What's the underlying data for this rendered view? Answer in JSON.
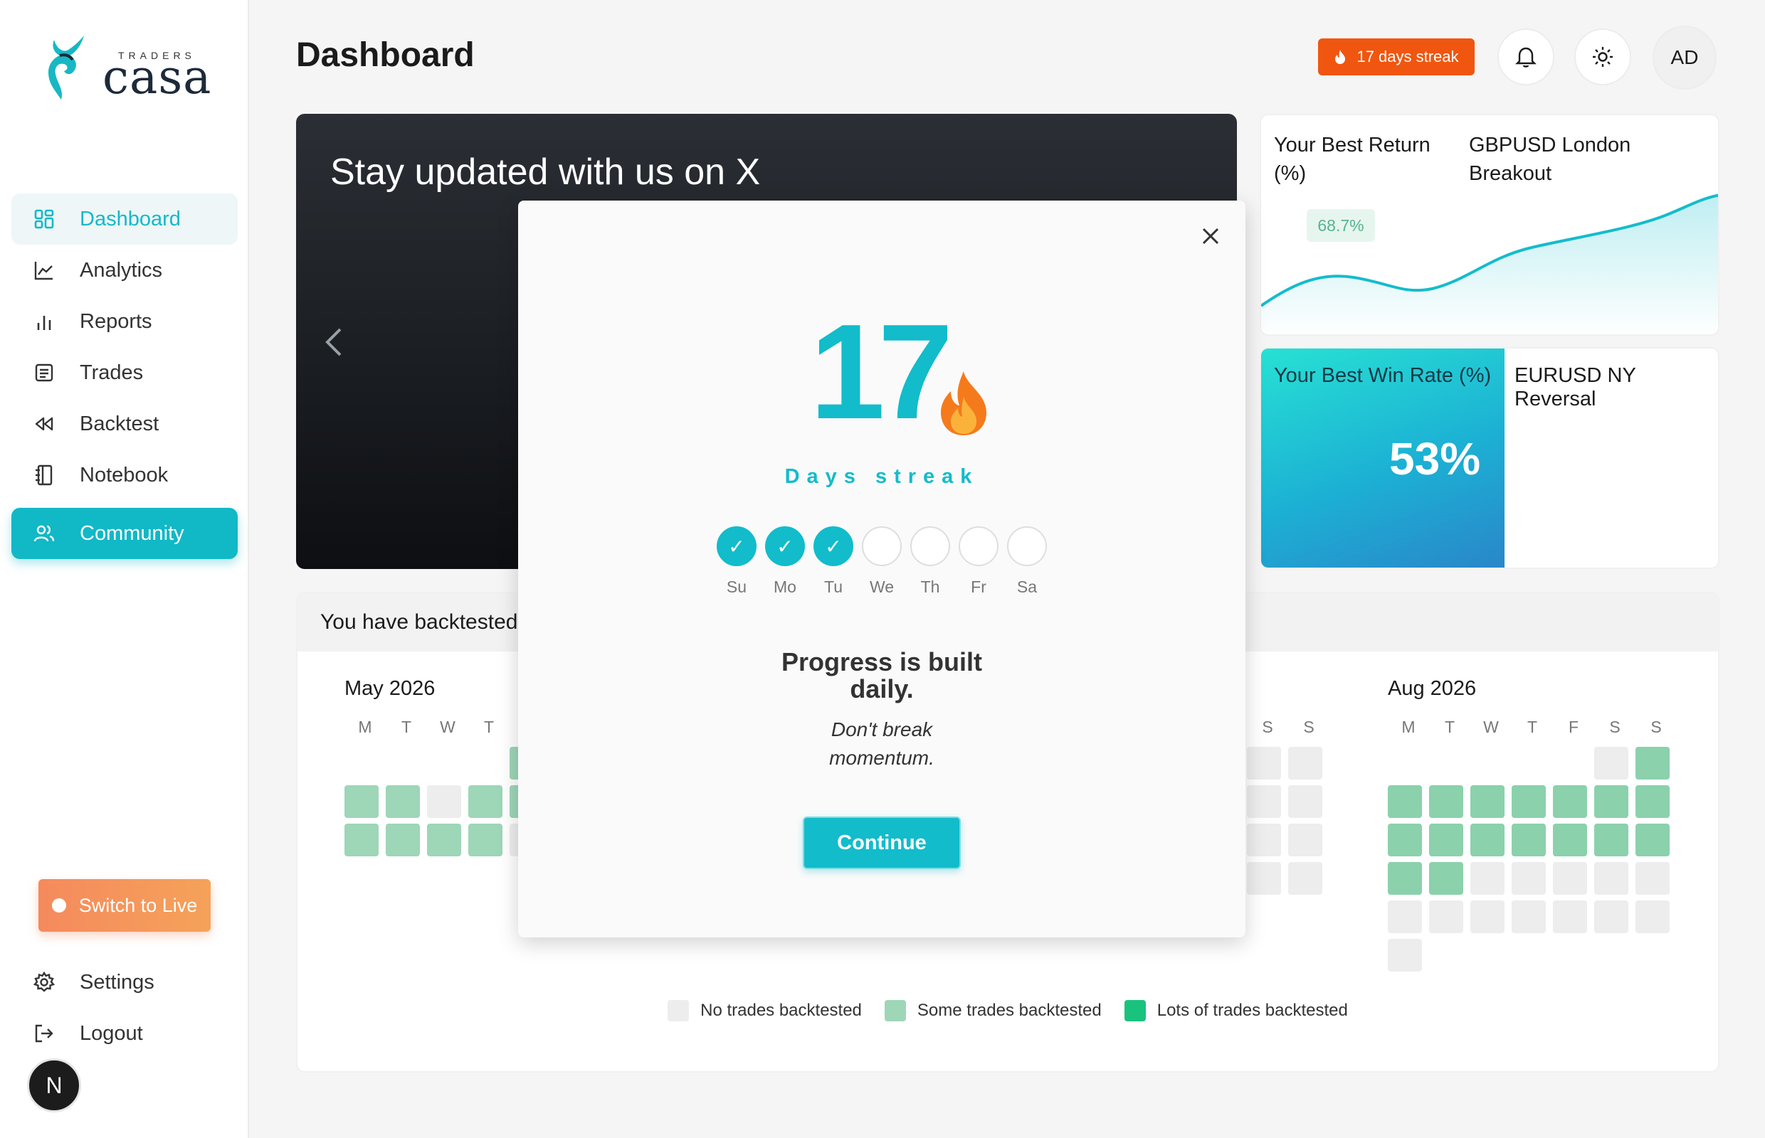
{
  "sidebar": {
    "logo": {
      "small": "TRADERS",
      "big": "casa"
    },
    "items": [
      {
        "label": "Dashboard",
        "icon": "grid-icon"
      },
      {
        "label": "Analytics",
        "icon": "line-chart-icon"
      },
      {
        "label": "Reports",
        "icon": "bar-chart-icon"
      },
      {
        "label": "Trades",
        "icon": "list-icon"
      },
      {
        "label": "Backtest",
        "icon": "rewind-icon"
      },
      {
        "label": "Notebook",
        "icon": "notebook-icon"
      },
      {
        "label": "Community",
        "icon": "users-icon"
      }
    ],
    "switch_live": "Switch to Live",
    "settings": "Settings",
    "logout": "Logout",
    "avatar": "N"
  },
  "header": {
    "title": "Dashboard",
    "streak": "17 days streak",
    "avatar": "AD"
  },
  "banner": {
    "title": "Stay updated with us on X"
  },
  "best_return": {
    "label": "Your Best Return (%)",
    "strategy": "GBPUSD London Breakout",
    "value": "68.7%"
  },
  "best_win": {
    "label": "Your Best Win Rate (%)",
    "strategy": "EURUSD NY Reversal",
    "value": "53%"
  },
  "heatmap": {
    "title": "You have backtested",
    "months": [
      {
        "name": "May 2026",
        "dow": [
          "M",
          "T",
          "W",
          "T"
        ]
      },
      {
        "name": "Aug 2026",
        "dow": [
          "M",
          "T",
          "W",
          "T",
          "F",
          "S",
          "S"
        ]
      }
    ],
    "middle_dow": [
      "S",
      "S"
    ],
    "legend": [
      "No trades backtested",
      "Some trades backtested",
      "Lots of trades backtested"
    ]
  },
  "modal": {
    "count": "17",
    "label": "Days streak",
    "days": [
      {
        "label": "Su",
        "done": true
      },
      {
        "label": "Mo",
        "done": true
      },
      {
        "label": "Tu",
        "done": true
      },
      {
        "label": "We",
        "done": false
      },
      {
        "label": "Th",
        "done": false
      },
      {
        "label": "Fr",
        "done": false
      },
      {
        "label": "Sa",
        "done": false
      }
    ],
    "msg1": "Progress is built",
    "msg2": "daily.",
    "sub1": "Don't break",
    "sub2": "momentum.",
    "continue": "Continue"
  },
  "colors": {
    "accent": "#12bccb",
    "streak": "#f0560f",
    "some": "#9ed6b8",
    "lots": "#19c37d",
    "none": "#ededed"
  }
}
